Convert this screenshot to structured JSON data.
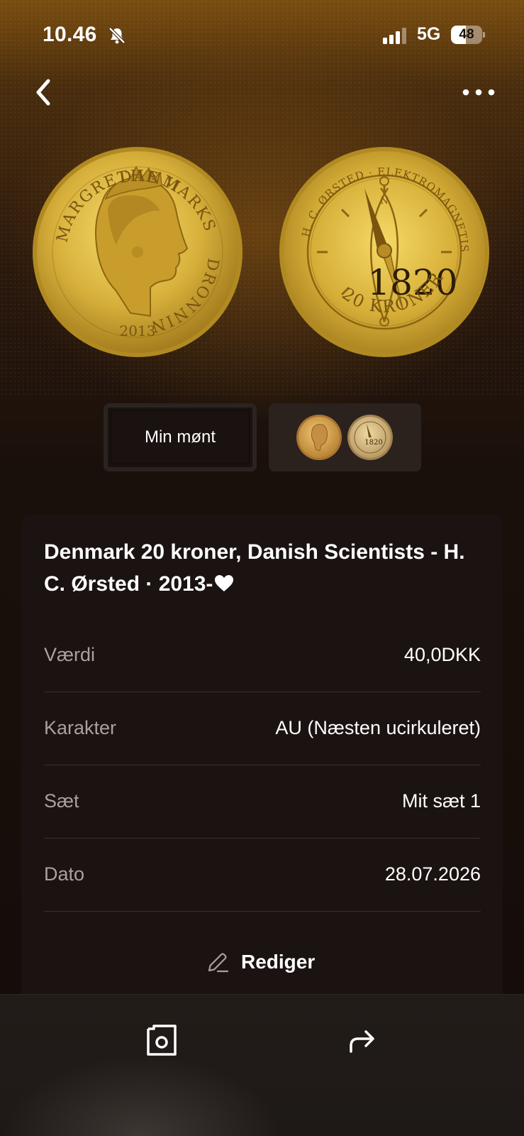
{
  "status_bar": {
    "time": "10.46",
    "network": "5G",
    "battery_percent": 48,
    "battery_label": "48",
    "silent_icon": "bell-slash-icon"
  },
  "nav": {
    "back_icon": "chevron-left-icon",
    "more_icon": "ellipsis-icon"
  },
  "coin_images": {
    "obverse": {
      "legend_top": "DANMARKS",
      "legend_right": "DRONNING",
      "legend_left": "MARGRETHE II",
      "year": "2013"
    },
    "reverse": {
      "legend": "H. C. ØRSTED · ELEKTROMAGNETISME",
      "year": "1820",
      "denomination": "20 KRONER",
      "north": "N"
    }
  },
  "tabs": {
    "mine_label": "Min mønt"
  },
  "card": {
    "title": "Denmark 20 kroner, Danish Scientists - H. C. Ørsted · 2013-",
    "favorite_icon": "heart-icon",
    "rows": [
      {
        "label": "Værdi",
        "value": "40,0DKK"
      },
      {
        "label": "Karakter",
        "value": "AU (Næsten ucirkuleret)"
      },
      {
        "label": "Sæt",
        "value": "Mit sæt 1"
      },
      {
        "label": "Dato",
        "value": "28.07.2026"
      }
    ],
    "edit_label": "Rediger",
    "edit_icon": "pencil-icon"
  },
  "bottom_bar": {
    "camera_icon": "camera-frame-icon",
    "share_icon": "share-arrow-icon"
  },
  "colors": {
    "gold": "#d9b23a",
    "card_bg": "#1b1311",
    "label_gray": "#a9a19d"
  }
}
